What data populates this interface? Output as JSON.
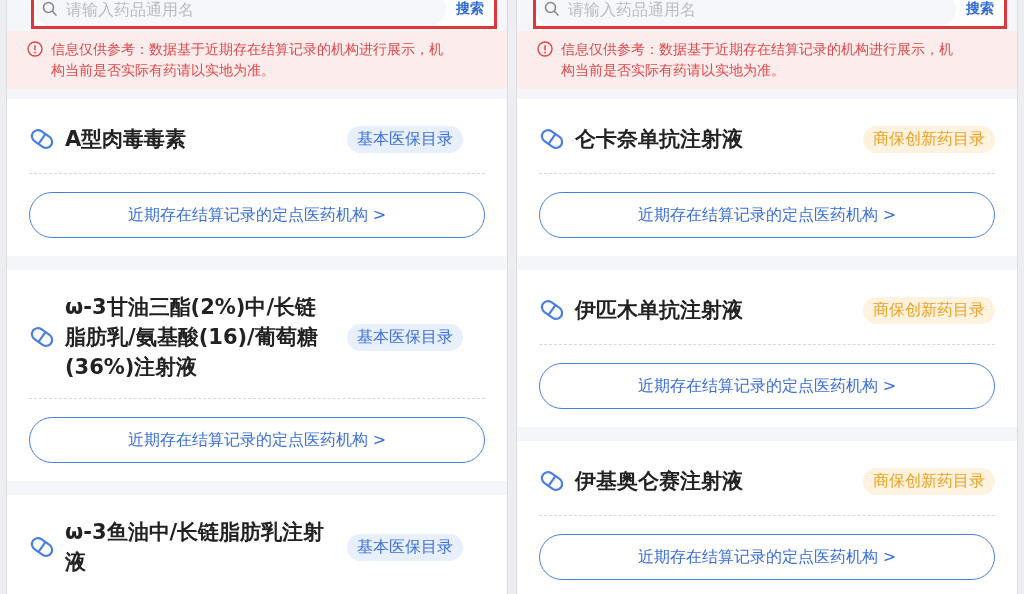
{
  "panels": [
    {
      "search": {
        "placeholder": "请输入药品通用名",
        "button": "搜索"
      },
      "notice": "信息仅供参考：数据基于近期存在结算记录的机构进行展示，机构当前是否实际有药请以实地为准。",
      "cards": [
        {
          "name": "A型肉毒毒素",
          "tag": "基本医保目录",
          "kind": "basic",
          "link": "近期存在结算记录的定点医药机构 >"
        },
        {
          "name": "ω-3甘油三酯(2%)中/长链脂肪乳/氨基酸(16)/葡萄糖(36%)注射液",
          "tag": "基本医保目录",
          "kind": "basic",
          "link": "近期存在结算记录的定点医药机构 >"
        },
        {
          "name": "ω-3鱼油中/长链脂肪乳注射液",
          "tag": "基本医保目录",
          "kind": "basic"
        }
      ]
    },
    {
      "search": {
        "placeholder": "请输入药品通用名",
        "button": "搜索"
      },
      "notice": "信息仅供参考：数据基于近期存在结算记录的机构进行展示，机构当前是否实际有药请以实地为准。",
      "cards": [
        {
          "name": "仑卡奈单抗注射液",
          "tag": "商保创新药目录",
          "kind": "commercial",
          "link": "近期存在结算记录的定点医药机构 >"
        },
        {
          "name": "伊匹木单抗注射液",
          "tag": "商保创新药目录",
          "kind": "commercial",
          "link": "近期存在结算记录的定点医药机构 >"
        },
        {
          "name": "伊基奥仑赛注射液",
          "tag": "商保创新药目录",
          "kind": "commercial",
          "link": "近期存在结算记录的定点医药机构 >"
        }
      ]
    }
  ]
}
